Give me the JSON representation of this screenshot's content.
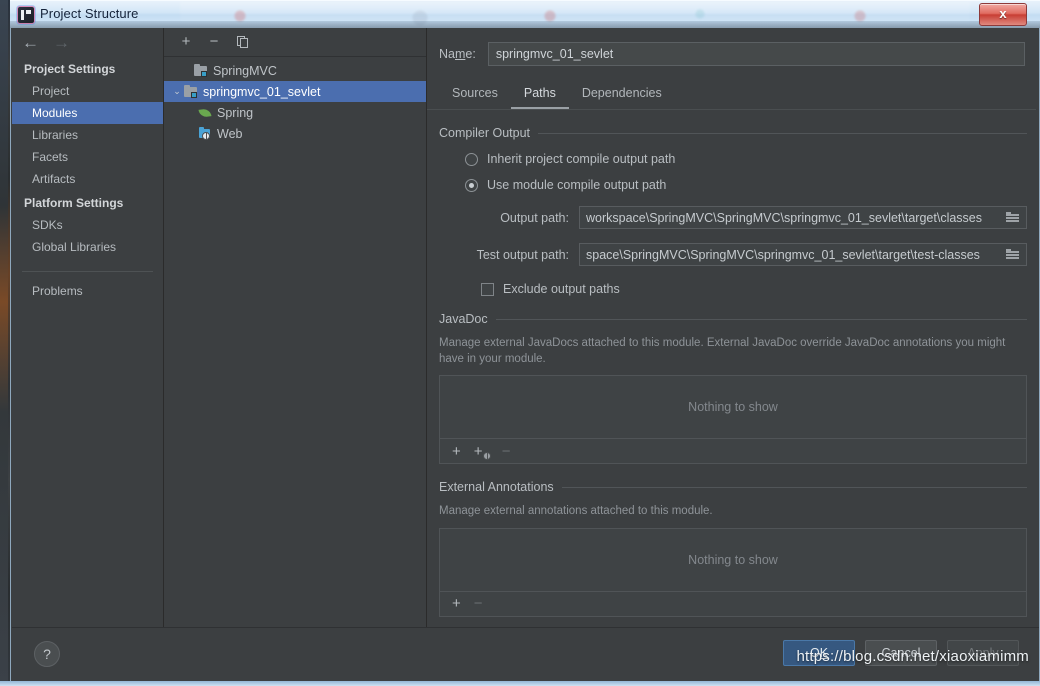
{
  "window": {
    "title": "Project Structure",
    "app_icon": "intellij-idea-icon",
    "close_label": "x"
  },
  "nav": {
    "back_icon": "arrow-left-icon",
    "forward_icon": "arrow-right-icon",
    "groups": [
      {
        "label": "Project Settings",
        "items": [
          {
            "label": "Project",
            "selected": false
          },
          {
            "label": "Modules",
            "selected": true
          },
          {
            "label": "Libraries",
            "selected": false
          },
          {
            "label": "Facets",
            "selected": false
          },
          {
            "label": "Artifacts",
            "selected": false
          }
        ]
      },
      {
        "label": "Platform Settings",
        "items": [
          {
            "label": "SDKs",
            "selected": false
          },
          {
            "label": "Global Libraries",
            "selected": false
          }
        ]
      }
    ],
    "problems": "Problems"
  },
  "tree": {
    "toolbar": {
      "add": "+",
      "remove": "−",
      "copy_icon": "copy-icon"
    },
    "nodes": [
      {
        "label": "SpringMVC",
        "icon": "module-icon",
        "indent": 1,
        "twisty": "",
        "selected": false
      },
      {
        "label": "springmvc_01_sevlet",
        "icon": "module-icon",
        "indent": 0,
        "twisty": "⌄",
        "selected": true
      },
      {
        "label": "Spring",
        "icon": "spring-leaf-icon",
        "indent": 2,
        "twisty": "",
        "selected": false
      },
      {
        "label": "Web",
        "icon": "web-globe-icon",
        "indent": 2,
        "twisty": "",
        "selected": false
      }
    ]
  },
  "module": {
    "name_label_pre": "Na",
    "name_label_mnemonic": "m",
    "name_label_post": "e:",
    "name_value": "springmvc_01_sevlet",
    "tabs": [
      {
        "label": "Sources",
        "active": false
      },
      {
        "label": "Paths",
        "active": true
      },
      {
        "label": "Dependencies",
        "active": false
      }
    ]
  },
  "compiler_output": {
    "section_title": "Compiler Output",
    "radio_inherit": "Inherit project compile output path",
    "radio_module": "Use module compile output path",
    "selected": "module",
    "output_path_label": "Output path:",
    "output_path_value": "workspace\\SpringMVC\\SpringMVC\\springmvc_01_sevlet\\target\\classes",
    "test_output_path_label": "Test output path:",
    "test_output_path_value": "space\\SpringMVC\\SpringMVC\\springmvc_01_sevlet\\target\\test-classes",
    "browse_icon": "folder-browse-icon",
    "exclude_label": "Exclude output paths",
    "exclude_checked": false
  },
  "javadoc": {
    "section_title": "JavaDoc",
    "description": "Manage external JavaDocs attached to this module. External JavaDoc override JavaDoc annotations you might have in your module.",
    "empty_text": "Nothing to show",
    "toolbar": {
      "add": "+",
      "add_url": "+",
      "add_url_icon": "add-url-globe-icon",
      "remove": "−"
    }
  },
  "external_annotations": {
    "section_title": "External Annotations",
    "description": "Manage external annotations attached to this module.",
    "empty_text": "Nothing to show",
    "toolbar": {
      "add": "+",
      "remove": "−"
    }
  },
  "footer": {
    "help_icon": "?",
    "ok_pre": "O",
    "ok_mnemonic": "K",
    "ok_label": "OK",
    "cancel_label": "Cancel",
    "apply_label": "Apply",
    "apply_disabled": true
  },
  "watermark": {
    "text": "https://blog.csdn.net/xiaoxiamimm"
  },
  "colors": {
    "panel_bg": "#3c3f41",
    "selection": "#4b6eaf",
    "primary_button": "#365880",
    "text": "#b9bec2",
    "muted_text": "#8e9398"
  }
}
